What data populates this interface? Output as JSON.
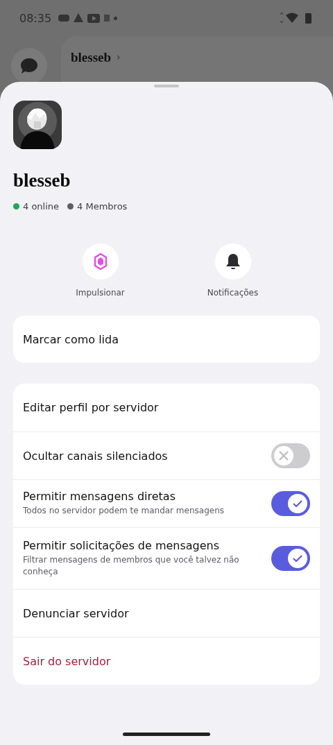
{
  "status_bar": {
    "time": "08:35"
  },
  "background_header": {
    "title": "blesseb",
    "chevron": "›"
  },
  "server": {
    "name": "blesseb",
    "online": "4 online",
    "members": "4 Membros"
  },
  "actions": [
    {
      "kind": "boost",
      "label": "Impulsionar"
    },
    {
      "kind": "bell",
      "label": "Notificações"
    }
  ],
  "mark_read": "Marcar como lida",
  "settings": [
    {
      "kind": "plain",
      "title": "Editar perfil por servidor"
    },
    {
      "kind": "toggle",
      "title": "Ocultar canais silenciados",
      "on": false
    },
    {
      "kind": "toggle",
      "title": "Permitir mensagens diretas",
      "subtitle": "Todos no servidor podem te mandar mensagens",
      "on": true
    },
    {
      "kind": "toggle",
      "title": "Permitir solicitações de mensagens",
      "subtitle": "Filtrar mensagens de membros que você talvez não conheça",
      "on": true
    },
    {
      "kind": "plain",
      "title": "Denunciar servidor"
    },
    {
      "kind": "danger",
      "title": "Sair do servidor"
    }
  ]
}
